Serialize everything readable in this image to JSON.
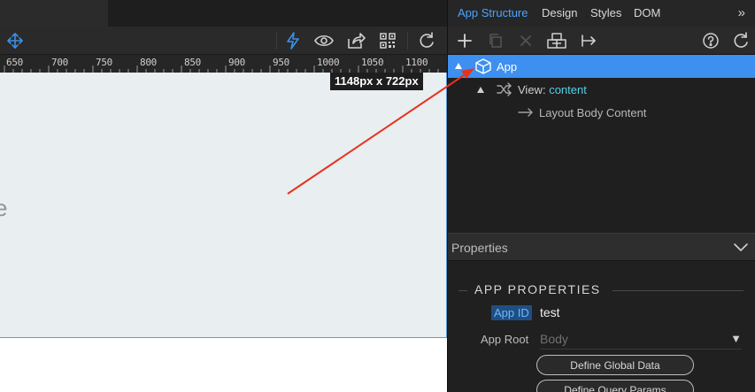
{
  "ruler": {
    "ticks": [
      "650",
      "700",
      "750",
      "800",
      "850",
      "900",
      "950",
      "1000",
      "1050",
      "1100"
    ]
  },
  "canvas": {
    "size_badge": "1148px x 722px",
    "partial_text": "e"
  },
  "tabs": [
    {
      "label": "App Structure",
      "active": true
    },
    {
      "label": "Design",
      "active": false
    },
    {
      "label": "Styles",
      "active": false
    },
    {
      "label": "DOM",
      "active": false
    }
  ],
  "more_tabs": "»",
  "tree": {
    "app": {
      "label": "App"
    },
    "view": {
      "prefix": "View:",
      "name": "content"
    },
    "layout": {
      "label": "Layout Body Content"
    }
  },
  "properties": {
    "header": "Properties",
    "section_title": "APP PROPERTIES",
    "app_id": {
      "label": "App ID",
      "value": "test"
    },
    "app_root": {
      "label": "App Root",
      "value": "Body",
      "caret": "▼"
    },
    "buttons": {
      "global_data": "Define Global Data",
      "query_params": "Define Query Params"
    }
  },
  "colors": {
    "accent": "#3d8ff0",
    "tab_active": "#4aa3ff",
    "view_name": "#4fd1e6",
    "annotation_arrow": "#e8321e",
    "toolbar_icon_blue": "#3b8fe8"
  },
  "icons": {
    "left_toolbar": [
      "move-arrows-icon",
      "lightning-icon",
      "eye-icon",
      "share-icon",
      "qr-code-icon",
      "refresh-icon"
    ],
    "structure_toolbar": [
      "add-icon",
      "copy-icon",
      "delete-icon",
      "component-icon",
      "insert-after-icon",
      "help-icon",
      "refresh-icon"
    ]
  }
}
